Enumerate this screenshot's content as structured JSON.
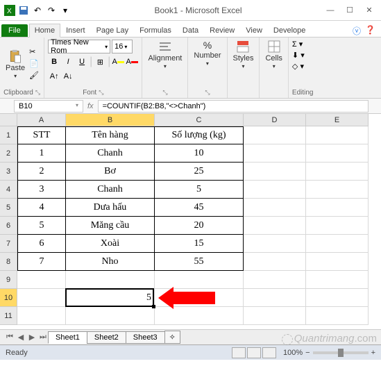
{
  "title": "Book1 - Microsoft Excel",
  "tabs": {
    "file": "File",
    "home": "Home",
    "insert": "Insert",
    "page": "Page Lay",
    "formulas": "Formulas",
    "data": "Data",
    "review": "Review",
    "view": "View",
    "developer": "Develope"
  },
  "ribbon": {
    "clipboard": {
      "label": "Clipboard",
      "paste": "Paste"
    },
    "font": {
      "label": "Font",
      "name": "Times New Rom",
      "size": "16",
      "b": "B",
      "i": "I",
      "u": "U"
    },
    "alignment": {
      "label": "Alignment"
    },
    "number": {
      "label": "Number"
    },
    "styles": {
      "label": "Styles"
    },
    "cells": {
      "label": "Cells"
    },
    "editing": {
      "label": "Editing"
    }
  },
  "namebox": "B10",
  "formula": "=COUNTIF(B2:B8,\"<>Chanh\")",
  "columns": [
    "A",
    "B",
    "C",
    "D",
    "E"
  ],
  "row_numbers": [
    "1",
    "2",
    "3",
    "4",
    "5",
    "6",
    "7",
    "8",
    "9",
    "10",
    "11"
  ],
  "table": {
    "headers": {
      "stt": "STT",
      "ten": "Tên hàng",
      "sl": "Số lượng (kg)"
    },
    "rows": [
      {
        "stt": "1",
        "ten": "Chanh",
        "sl": "10"
      },
      {
        "stt": "2",
        "ten": "Bơ",
        "sl": "25"
      },
      {
        "stt": "3",
        "ten": "Chanh",
        "sl": "5"
      },
      {
        "stt": "4",
        "ten": "Dưa hấu",
        "sl": "45"
      },
      {
        "stt": "5",
        "ten": "Măng cầu",
        "sl": "20"
      },
      {
        "stt": "6",
        "ten": "Xoài",
        "sl": "15"
      },
      {
        "stt": "7",
        "ten": "Nho",
        "sl": "55"
      }
    ]
  },
  "result_cell": "5",
  "sheets": {
    "s1": "Sheet1",
    "s2": "Sheet2",
    "s3": "Sheet3"
  },
  "status": {
    "ready": "Ready",
    "zoom": "100%"
  },
  "watermark": "Quantrimang"
}
